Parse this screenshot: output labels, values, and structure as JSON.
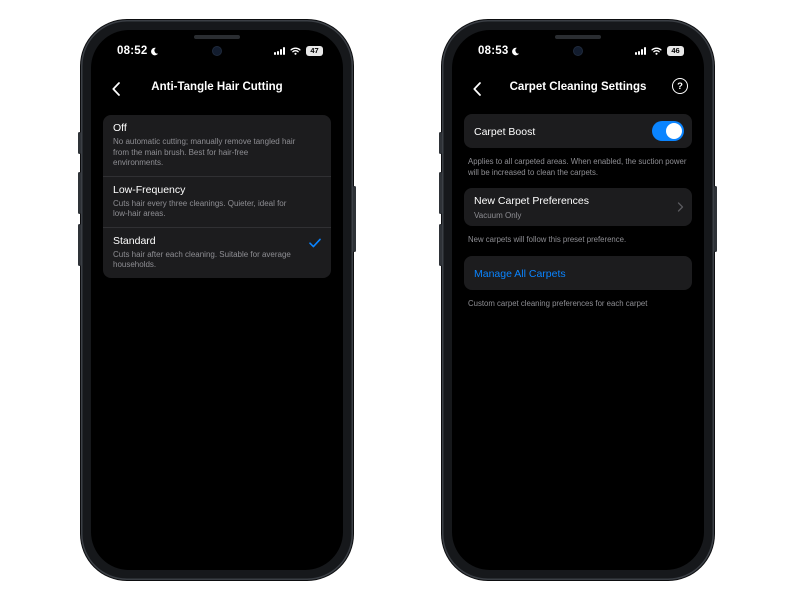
{
  "colors": {
    "accent": "#0a84ff",
    "secondary_text": "#8e8e93",
    "cell_bg": "#1c1c1e",
    "screen_bg": "#000000"
  },
  "left_phone": {
    "status": {
      "time": "08:52",
      "battery": "47",
      "icons": [
        "moon-icon",
        "cellular-signal-icon",
        "wifi-icon",
        "battery-icon"
      ]
    },
    "nav": {
      "title": "Anti-Tangle Hair Cutting",
      "back_icon": "chevron-left-icon"
    },
    "options": [
      {
        "title": "Off",
        "description": "No automatic cutting; manually remove tangled hair from the main brush. Best for hair-free environments.",
        "selected": false
      },
      {
        "title": "Low-Frequency",
        "description": "Cuts hair every three cleanings. Quieter, ideal for low-hair areas.",
        "selected": false
      },
      {
        "title": "Standard",
        "description": "Cuts hair after each cleaning. Suitable for average households.",
        "selected": true
      }
    ]
  },
  "right_phone": {
    "status": {
      "time": "08:53",
      "battery": "46",
      "icons": [
        "moon-icon",
        "cellular-signal-icon",
        "wifi-icon",
        "battery-icon"
      ]
    },
    "nav": {
      "title": "Carpet Cleaning Settings",
      "back_icon": "chevron-left-icon",
      "help_icon": "help-circle-icon",
      "help_glyph": "?"
    },
    "carpet_boost": {
      "label": "Carpet Boost",
      "enabled": true,
      "footnote": "Applies to all carpeted areas. When enabled, the suction power will be increased to clean the carpets."
    },
    "new_carpet_preferences": {
      "label": "New Carpet Preferences",
      "value": "Vacuum Only",
      "footnote": "New carpets will follow this preset preference."
    },
    "manage_all_carpets": {
      "label": "Manage All Carpets",
      "footnote": "Custom carpet cleaning preferences for each carpet"
    }
  }
}
